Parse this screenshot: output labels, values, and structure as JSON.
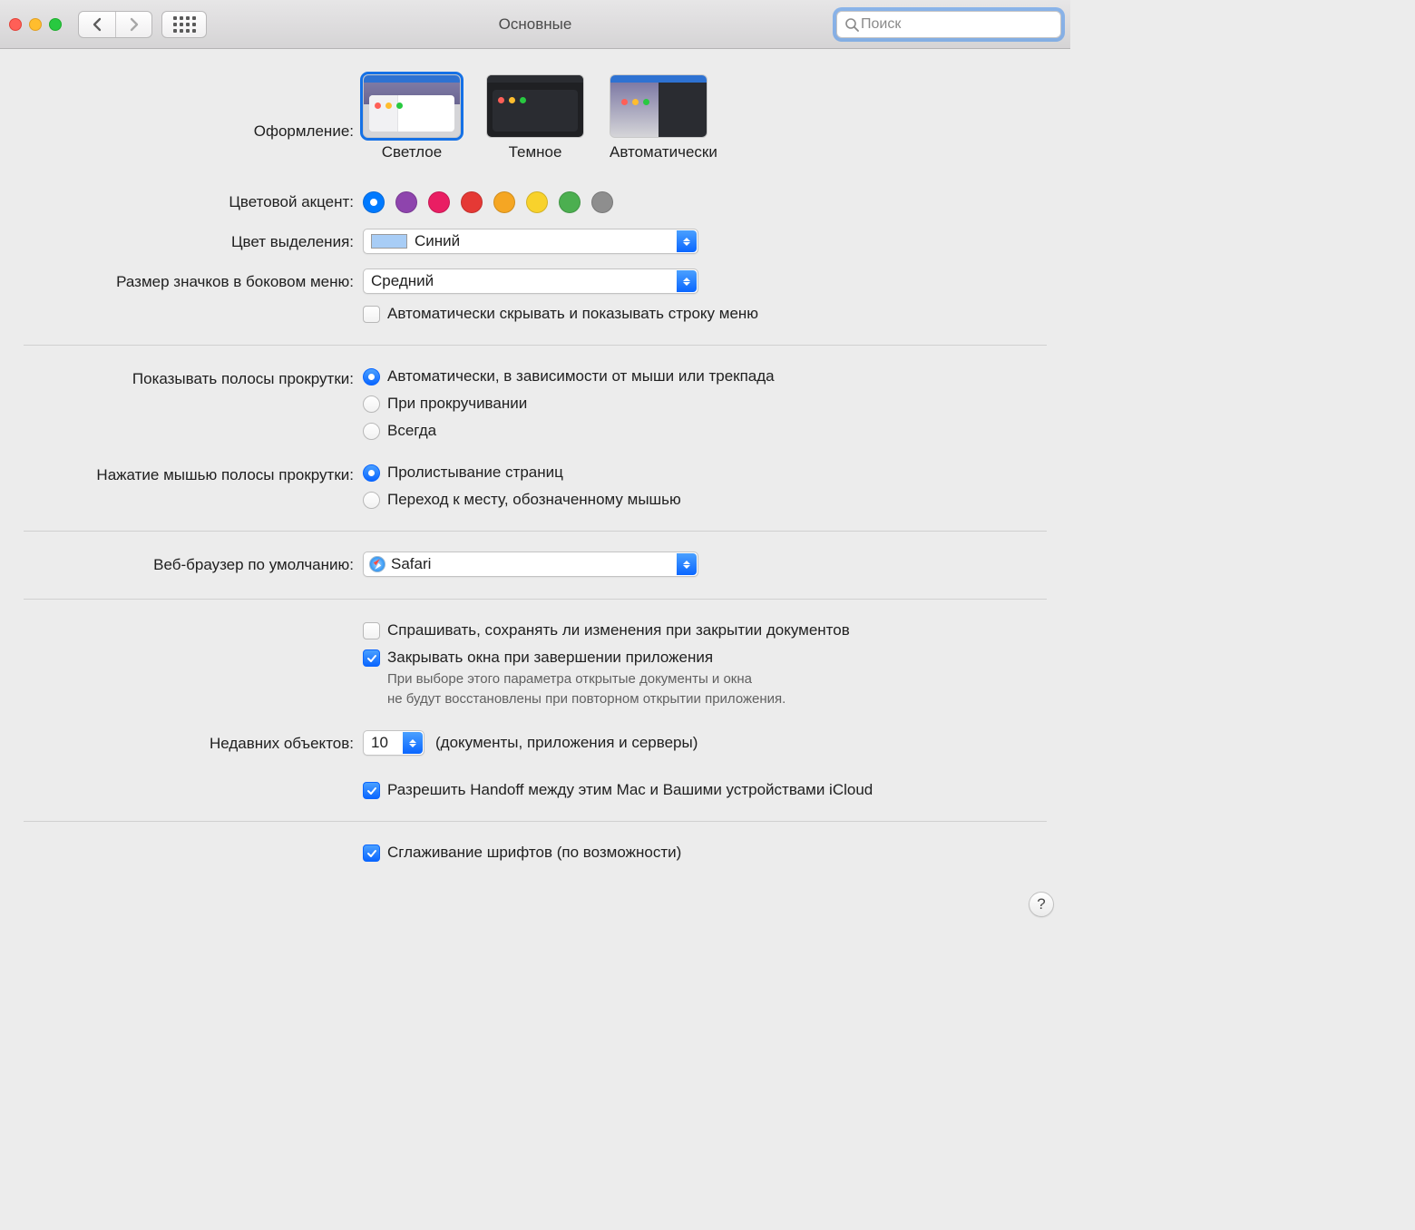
{
  "window": {
    "title": "Основные"
  },
  "search": {
    "placeholder": "Поиск"
  },
  "appearance": {
    "label": "Оформление:",
    "options": [
      {
        "key": "light",
        "label": "Светлое",
        "selected": true
      },
      {
        "key": "dark",
        "label": "Темное",
        "selected": false
      },
      {
        "key": "auto",
        "label": "Автоматически",
        "selected": false
      }
    ]
  },
  "accent": {
    "label": "Цветовой акцент:",
    "colors": [
      "#007aff",
      "#8e44ad",
      "#e91e63",
      "#e53935",
      "#f5a623",
      "#f8d22c",
      "#4caf50",
      "#8e8e8e"
    ],
    "selected_index": 0
  },
  "highlight": {
    "label": "Цвет выделения:",
    "value": "Синий"
  },
  "sidebar_icon": {
    "label": "Размер значков в боковом меню:",
    "value": "Средний"
  },
  "menubar_hide": {
    "label": "Автоматически скрывать и показывать строку меню",
    "checked": false
  },
  "scroll_show": {
    "label": "Показывать полосы прокрутки:",
    "options": [
      {
        "label": "Автоматически, в зависимости от мыши или трекпада",
        "checked": true
      },
      {
        "label": "При прокручивании",
        "checked": false
      },
      {
        "label": "Всегда",
        "checked": false
      }
    ]
  },
  "scroll_click": {
    "label": "Нажатие мышью полосы прокрутки:",
    "options": [
      {
        "label": "Пролистывание страниц",
        "checked": true
      },
      {
        "label": "Переход к месту, обозначенному мышью",
        "checked": false
      }
    ]
  },
  "browser": {
    "label": "Веб-браузер по умолчанию:",
    "value": "Safari"
  },
  "ask_save": {
    "label": "Спрашивать, сохранять ли изменения при закрытии документов",
    "checked": false
  },
  "close_windows": {
    "label": "Закрывать окна при завершении приложения",
    "checked": true,
    "note1": "При выборе этого параметра открытые документы и окна",
    "note2": "не будут восстановлены при повторном открытии приложения."
  },
  "recent": {
    "label": "Недавних объектов:",
    "value": "10",
    "suffix": "(документы, приложения и серверы)"
  },
  "handoff": {
    "label": "Разрешить Handoff между этим Mac и Вашими устройствами iCloud",
    "checked": true
  },
  "font_smoothing": {
    "label": "Сглаживание шрифтов (по возможности)",
    "checked": true
  },
  "help": "?"
}
